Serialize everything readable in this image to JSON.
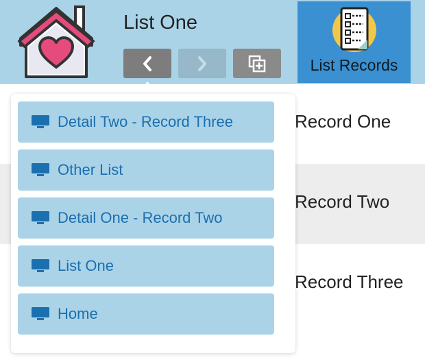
{
  "header": {
    "title": "List One",
    "list_records_label": "List Records",
    "icons": {
      "home": "house-heart-icon",
      "back": "chevron-left-icon",
      "forward": "chevron-right-icon",
      "copy": "copy-plus-icon",
      "list_records": "checklist-icon"
    }
  },
  "history_menu": {
    "items": [
      {
        "label": "Detail Two - Record Three",
        "icon": "monitor-icon"
      },
      {
        "label": "Other List",
        "icon": "monitor-icon"
      },
      {
        "label": "Detail One - Record Two",
        "icon": "monitor-icon"
      },
      {
        "label": "List One",
        "icon": "monitor-icon"
      },
      {
        "label": "Home",
        "icon": "monitor-icon"
      }
    ]
  },
  "table": {
    "rows": [
      {
        "label": "Record One"
      },
      {
        "label": "Record Two"
      },
      {
        "label": "Record Three"
      }
    ]
  },
  "colors": {
    "header_bg": "#aad3e8",
    "list_records_bg": "#3a90d0",
    "history_item_bg": "#aad3e8",
    "history_text": "#1c6fae"
  }
}
